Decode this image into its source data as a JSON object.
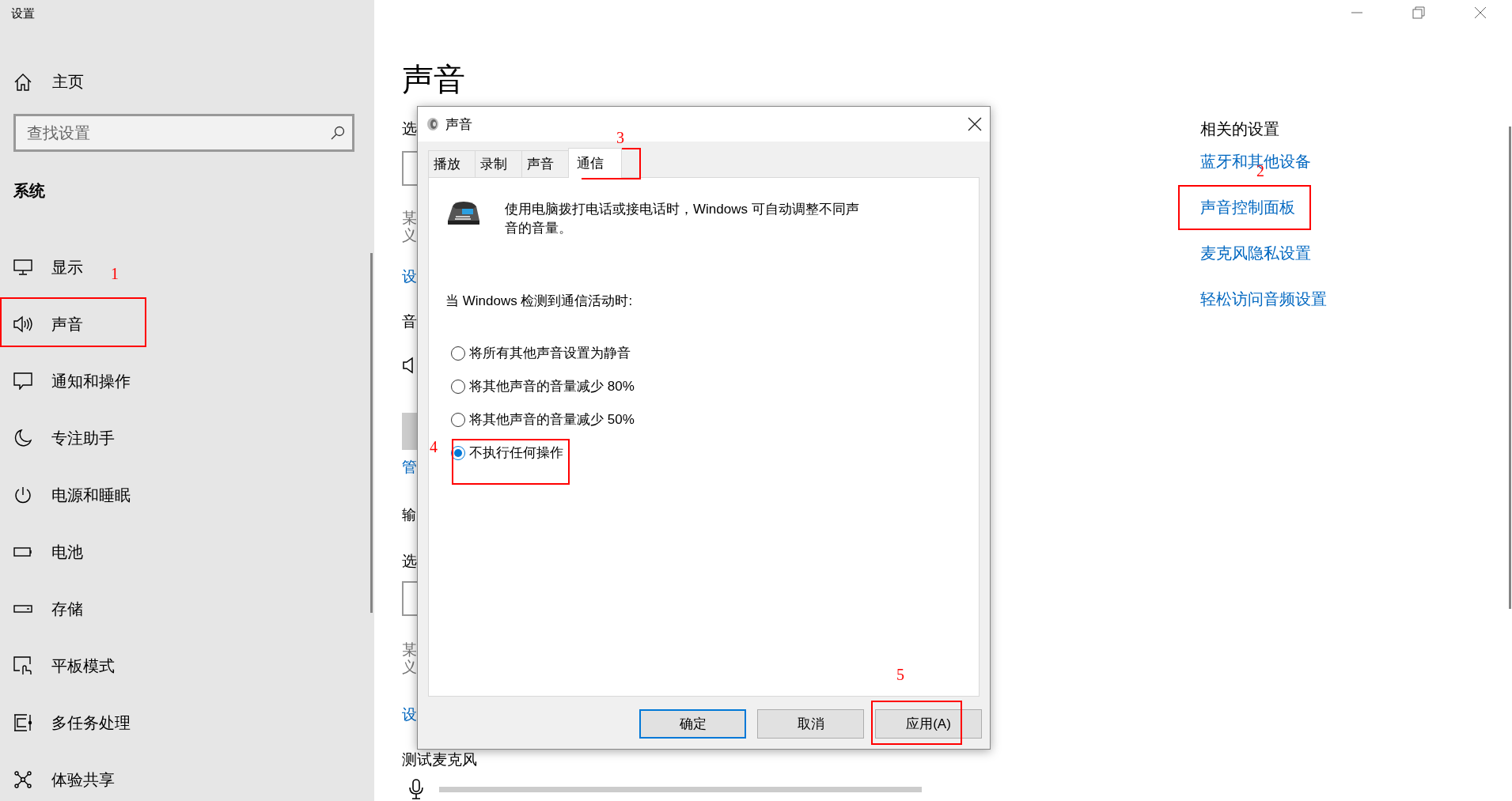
{
  "window": {
    "title": "设置"
  },
  "sidebar": {
    "home": "主页",
    "search": {
      "placeholder": "查找设置"
    },
    "section": "系统",
    "items": [
      {
        "label": "显示",
        "kind": "display"
      },
      {
        "label": "声音",
        "kind": "sound"
      },
      {
        "label": "通知和操作",
        "kind": "notification"
      },
      {
        "label": "专注助手",
        "kind": "moon"
      },
      {
        "label": "电源和睡眠",
        "kind": "power"
      },
      {
        "label": "电池",
        "kind": "battery"
      },
      {
        "label": "存储",
        "kind": "storage"
      },
      {
        "label": "平板模式",
        "kind": "tablet"
      },
      {
        "label": "多任务处理",
        "kind": "multitask"
      },
      {
        "label": "体验共享",
        "kind": "share"
      }
    ]
  },
  "page": {
    "title": "声音",
    "fragments": [
      {
        "kind": "label",
        "text": "选"
      },
      {
        "kind": "dropdown"
      },
      {
        "kind": "desc",
        "text": "某",
        "text2": "义"
      },
      {
        "kind": "link",
        "text": "设"
      },
      {
        "kind": "label",
        "text": "音"
      },
      {
        "kind": "speaker"
      },
      {
        "kind": "block"
      },
      {
        "kind": "link",
        "text": "管"
      },
      {
        "kind": "heading",
        "text": "输"
      },
      {
        "kind": "label",
        "text": "选"
      },
      {
        "kind": "dropdown"
      },
      {
        "kind": "desc",
        "text": "某",
        "text2": "义"
      },
      {
        "kind": "link",
        "text": "设"
      },
      {
        "kind": "label",
        "text": "测试麦克风"
      },
      {
        "kind": "meter",
        "level": 0
      }
    ]
  },
  "related": {
    "title": "相关的设置",
    "links": [
      "蓝牙和其他设备",
      "声音控制面板",
      "麦克风隐私设置",
      "轻松访问音频设置"
    ]
  },
  "dialog": {
    "title": "声音",
    "tabs": [
      {
        "label": "播放",
        "selected": false
      },
      {
        "label": "录制",
        "selected": false
      },
      {
        "label": "声音",
        "selected": false
      },
      {
        "label": "通信",
        "selected": true
      }
    ],
    "description": "使用电脑拨打电话或接电话时，Windows 可自动调整不同声音的音量。",
    "prompt": "当 Windows 检测到通信活动时:",
    "options": [
      {
        "label": "将所有其他声音设置为静音",
        "selected": false
      },
      {
        "label": "将其他声音的音量减少 80%",
        "selected": false
      },
      {
        "label": "将其他声音的音量减少 50%",
        "selected": false
      },
      {
        "label": "不执行任何操作",
        "selected": true
      }
    ],
    "buttons": [
      {
        "label": "确定",
        "default": true
      },
      {
        "label": "取消",
        "default": false
      },
      {
        "label": "应用(A)",
        "default": false
      }
    ]
  },
  "annotations": [
    {
      "number": "1"
    },
    {
      "number": "2"
    },
    {
      "number": "3"
    },
    {
      "number": "4"
    },
    {
      "number": "5"
    }
  ]
}
